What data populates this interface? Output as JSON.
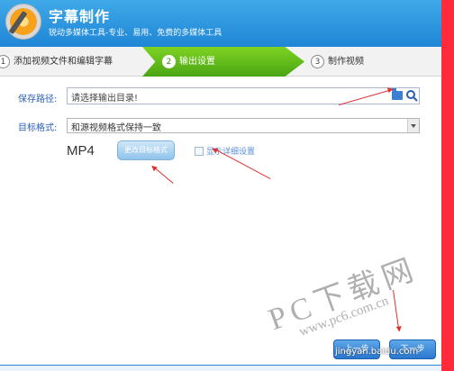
{
  "header": {
    "title": "字幕制作",
    "subtitle": "锐动多媒体工具-专业、易用、免费的多媒体工具"
  },
  "steps": [
    {
      "num": "1",
      "label": "添加视频文件和编辑字幕",
      "active": false
    },
    {
      "num": "2",
      "label": "输出设置",
      "active": true
    },
    {
      "num": "3",
      "label": "制作视频",
      "active": false
    }
  ],
  "form": {
    "save_path_label": "保存路径:",
    "save_path_value": "请选择输出目录!",
    "target_format_label": "目标格式:",
    "target_format_value": "和源视频格式保持一致",
    "format_value": "MP4",
    "change_format_label": "更改目标格式",
    "show_details_label": "显示详细设置"
  },
  "buttons": {
    "prev_label": "上一步",
    "next_label": "下一步"
  },
  "watermark": {
    "main": "PC下载网",
    "sub": "www.pc6.com.cn",
    "baidu": "jingyan.baidu.com"
  },
  "colors": {
    "header": "#2b93dd",
    "active_step": "#5cb81b",
    "accent_red": "#e03030"
  }
}
